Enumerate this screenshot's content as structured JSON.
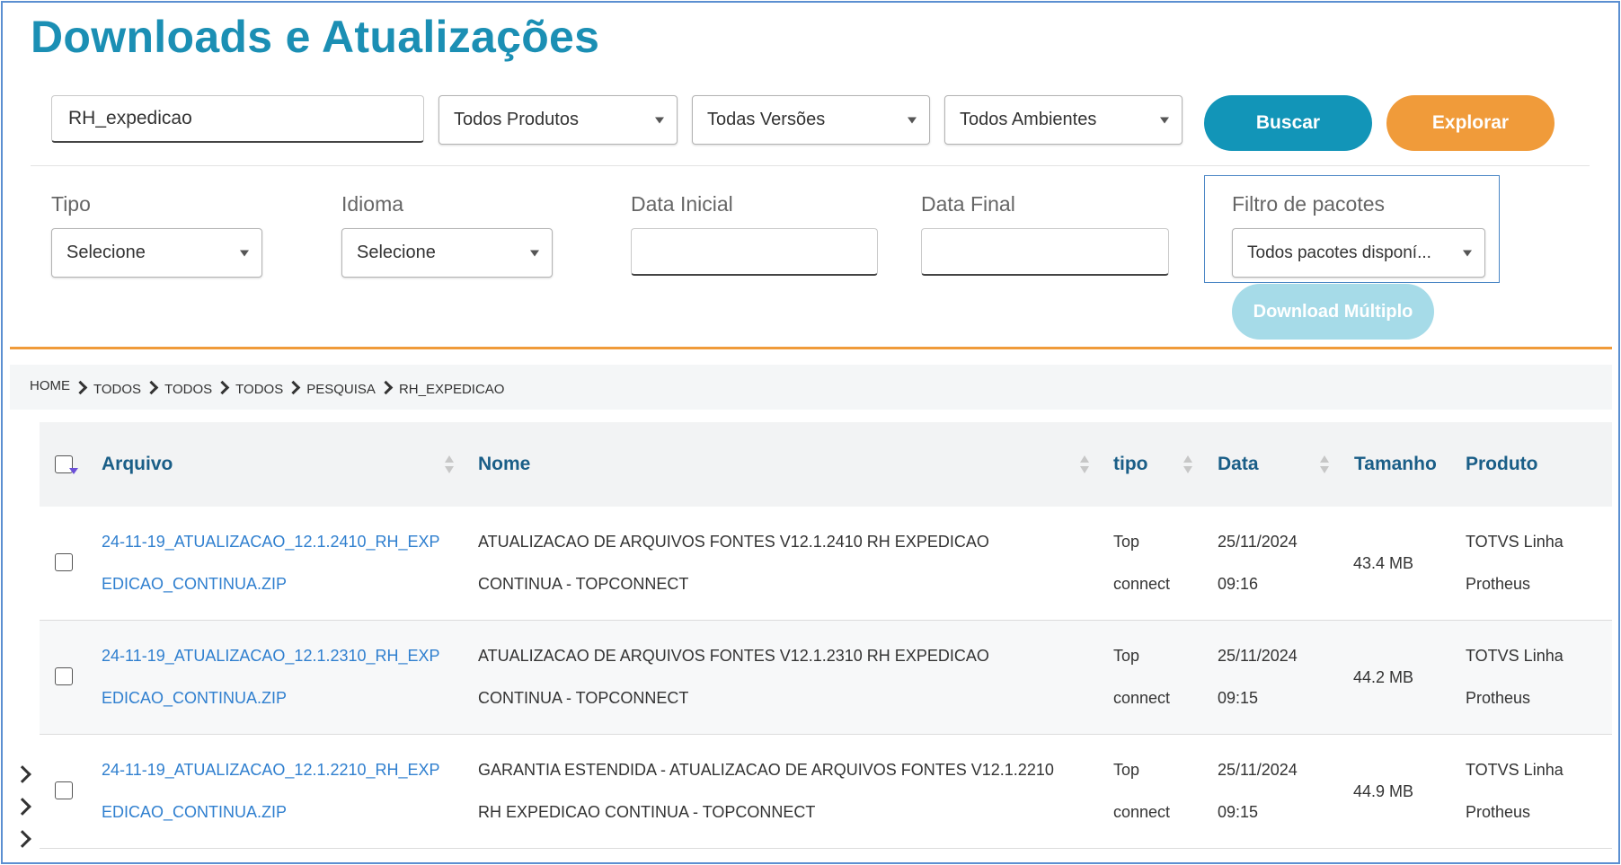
{
  "page": {
    "title": "Downloads e Atualizações"
  },
  "search": {
    "query": "RH_expedicao",
    "product_select": "Todos Produtos",
    "version_select": "Todas Versões",
    "environment_select": "Todos Ambientes",
    "search_button": "Buscar",
    "explore_button": "Explorar"
  },
  "filters": {
    "tipo_label": "Tipo",
    "tipo_value": "Selecione",
    "idioma_label": "Idioma",
    "idioma_value": "Selecione",
    "data_inicial_label": "Data Inicial",
    "data_inicial_value": "",
    "data_final_label": "Data Final",
    "data_final_value": "",
    "pacotes_label": "Filtro de pacotes",
    "pacotes_value": "Todos pacotes disponí...",
    "multi_download_button": "Download Múltiplo"
  },
  "breadcrumb": [
    "HOME",
    "TODOS",
    "TODOS",
    "TODOS",
    "PESQUISA",
    "RH_EXPEDICAO"
  ],
  "table": {
    "headers": {
      "arquivo": "Arquivo",
      "nome": "Nome",
      "tipo": "tipo",
      "data": "Data",
      "tamanho": "Tamanho",
      "produto": "Produto"
    },
    "rows": [
      {
        "arquivo_l1": "24-11-19_ATUALIZACAO_12.1.2410_RH_EXP",
        "arquivo_l2": "EDICAO_CONTINUA.ZIP",
        "nome_l1": "ATUALIZACAO DE ARQUIVOS FONTES V12.1.2410 RH EXPEDICAO",
        "nome_l2": "CONTINUA - TOPCONNECT",
        "tipo_l1": "Top",
        "tipo_l2": "connect",
        "data_l1": "25/11/2024",
        "data_l2": "09:16",
        "tamanho": "43.4 MB",
        "produto_l1": "TOTVS Linha",
        "produto_l2": "Protheus"
      },
      {
        "arquivo_l1": "24-11-19_ATUALIZACAO_12.1.2310_RH_EXP",
        "arquivo_l2": "EDICAO_CONTINUA.ZIP",
        "nome_l1": "ATUALIZACAO DE ARQUIVOS FONTES V12.1.2310 RH EXPEDICAO",
        "nome_l2": "CONTINUA - TOPCONNECT",
        "tipo_l1": "Top",
        "tipo_l2": "connect",
        "data_l1": "25/11/2024",
        "data_l2": "09:15",
        "tamanho": "44.2 MB",
        "produto_l1": "TOTVS Linha",
        "produto_l2": "Protheus"
      },
      {
        "arquivo_l1": "24-11-19_ATUALIZACAO_12.1.2210_RH_EXP",
        "arquivo_l2": "EDICAO_CONTINUA.ZIP",
        "nome_l1": "GARANTIA ESTENDIDA - ATUALIZACAO DE ARQUIVOS FONTES V12.1.2210",
        "nome_l2": "RH EXPEDICAO CONTINUA - TOPCONNECT",
        "tipo_l1": "Top",
        "tipo_l2": "connect",
        "data_l1": "25/11/2024",
        "data_l2": "09:15",
        "tamanho": "44.9 MB",
        "produto_l1": "TOTVS Linha",
        "produto_l2": "Protheus"
      }
    ]
  },
  "colors": {
    "title": "#1b8fb4",
    "primary_button": "#1295b8",
    "secondary_button": "#f09b3a",
    "disabled_button": "#a6dbe8",
    "link": "#2f7fcf",
    "header_text": "#1a5e87"
  },
  "icons": [
    "chevron-right-icon",
    "dropdown-caret-icon",
    "sort-icon",
    "checkbox-icon"
  ]
}
